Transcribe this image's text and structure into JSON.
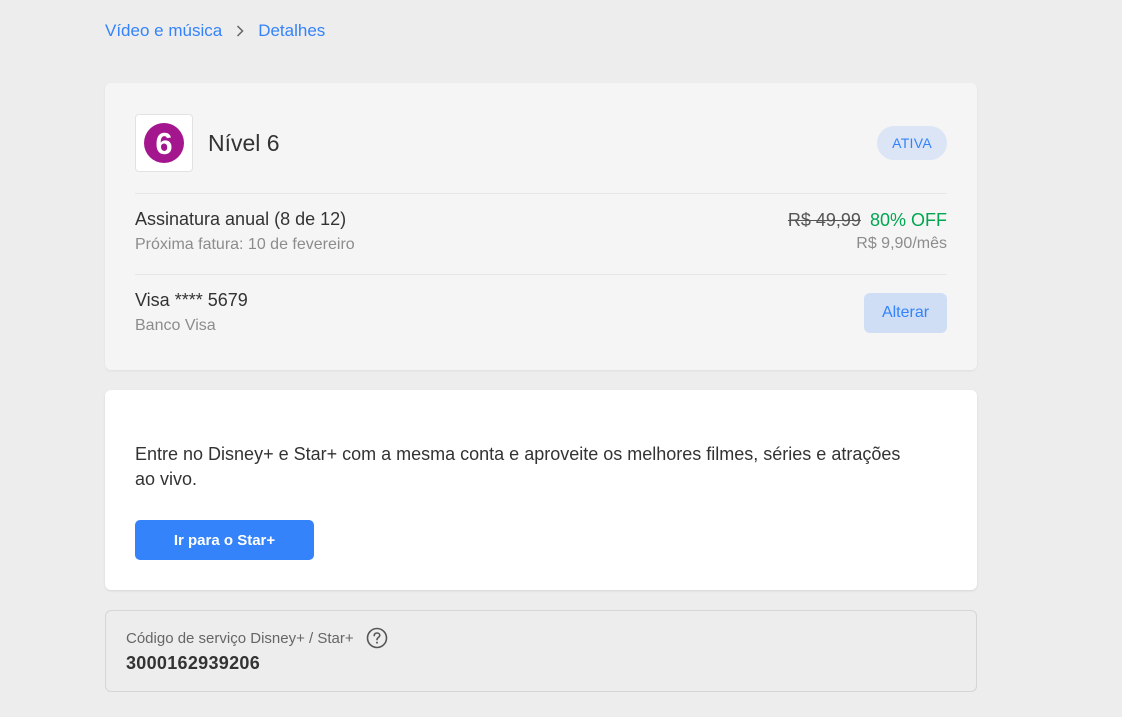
{
  "breadcrumb": {
    "parent": "Vídeo e música",
    "current": "Detalhes"
  },
  "subscription": {
    "logo_digit": "6",
    "plan_name": "Nível 6",
    "status": "ATIVA",
    "billing_title": "Assinatura anual (8 de 12)",
    "next_invoice": "Próxima fatura: 10 de fevereiro",
    "price_old": "R$ 49,99",
    "discount": "80% OFF",
    "price_monthly": "R$ 9,90/mês",
    "card_title": "Visa **** 5679",
    "card_bank": "Banco Visa",
    "change_label": "Alterar"
  },
  "promo": {
    "text": "Entre no Disney+ e Star+ com a mesma conta e aproveite os melhores filmes, séries e atrações ao vivo.",
    "button_label": "Ir para o Star+"
  },
  "service_code": {
    "label": "Código de serviço Disney+ / Star+",
    "value": "3000162939206"
  },
  "colors": {
    "accent": "#3483fa",
    "brand_purple": "#a4168e",
    "discount_green": "#00a650",
    "background": "#ededed"
  }
}
